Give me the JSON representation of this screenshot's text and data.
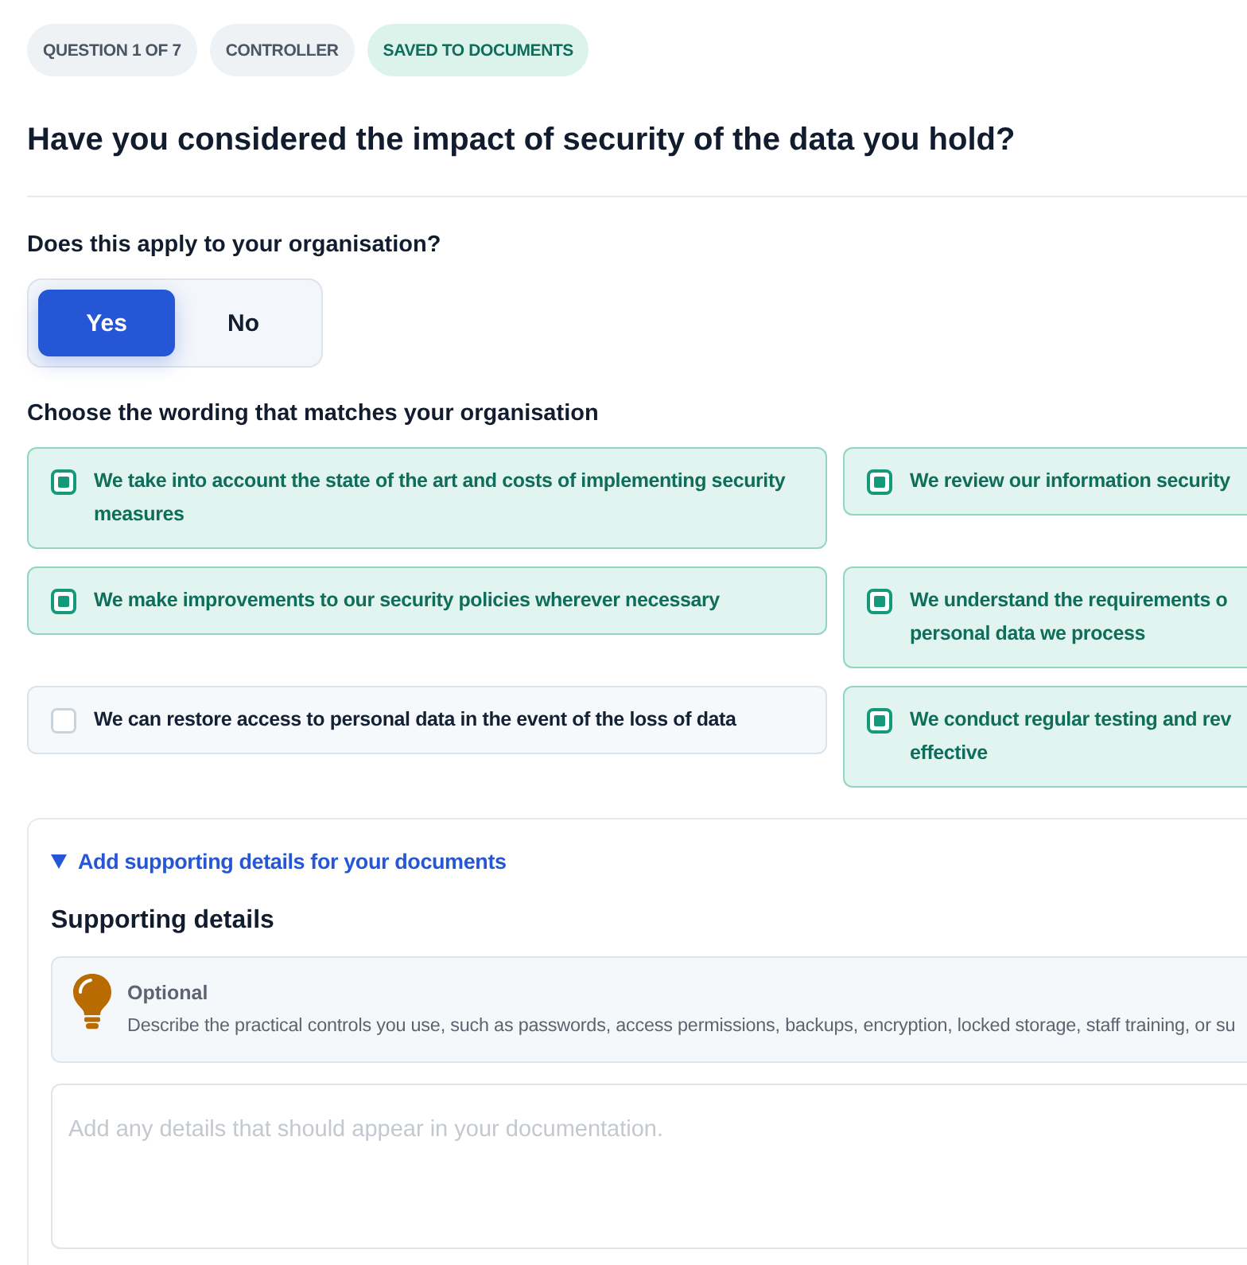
{
  "badges": [
    {
      "label": "QUESTION 1 OF 7",
      "kind": "neutral"
    },
    {
      "label": "CONTROLLER",
      "kind": "neutral"
    },
    {
      "label": "SAVED TO DOCUMENTS",
      "kind": "success"
    }
  ],
  "question": {
    "title": "Have you considered the impact of security of the data you hold?"
  },
  "applies": {
    "label": "Does this apply to your organisation?",
    "options": [
      {
        "label": "Yes",
        "selected": true
      },
      {
        "label": "No",
        "selected": false
      }
    ]
  },
  "wording": {
    "label": "Choose the wording that matches your organisation",
    "options": [
      {
        "label": "We take into account the state of the art and costs of implementing security measures",
        "checked": true
      },
      {
        "label": "We review our information security",
        "checked": true
      },
      {
        "label": "We make improvements to our security policies wherever necessary",
        "checked": true
      },
      {
        "label": "We understand the requirements o personal data we process",
        "checked": true
      },
      {
        "label": "We can restore access to personal data in the event of the loss of data",
        "checked": false
      },
      {
        "label": "We conduct regular testing and rev effective",
        "checked": true
      }
    ]
  },
  "details": {
    "toggle": {
      "label": "Add supporting details for your documents",
      "expanded": true
    },
    "heading": "Supporting details",
    "hint": {
      "title": "Optional",
      "text": "Describe the practical controls you use, such as passwords, access permissions, backups, encryption, locked storage, staff training, or su"
    },
    "field": {
      "placeholder": "Add any details that should appear in your documentation."
    }
  }
}
